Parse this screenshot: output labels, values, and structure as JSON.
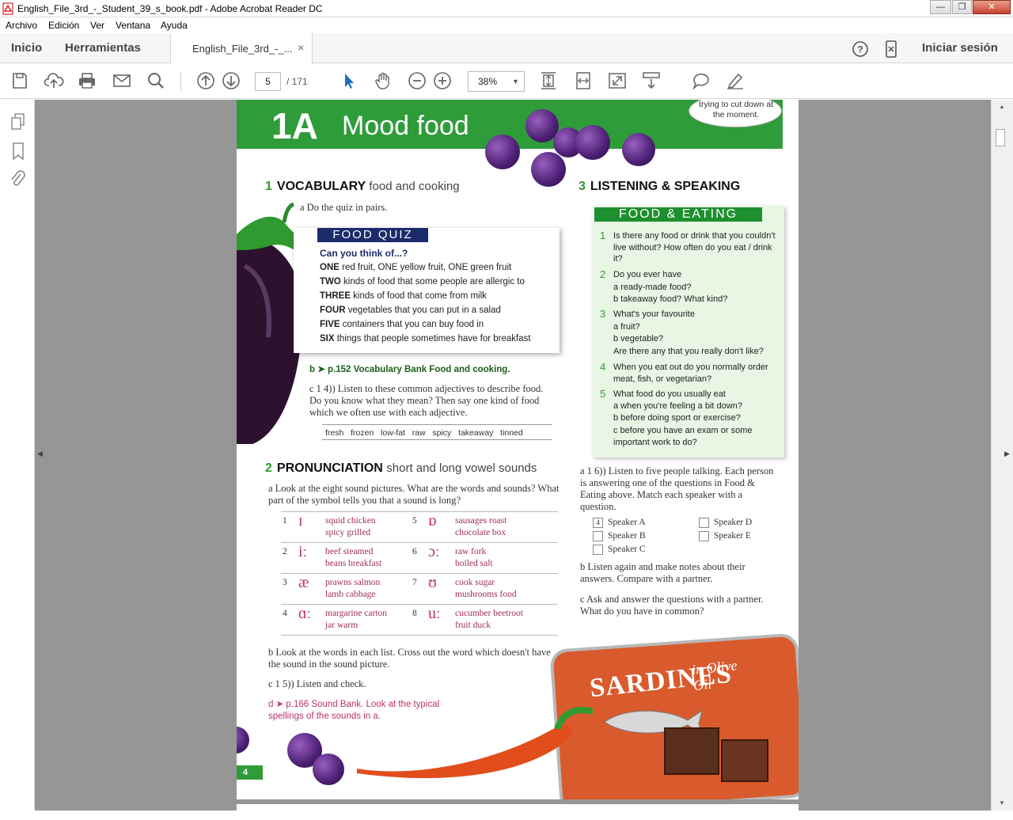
{
  "window": {
    "title": "English_File_3rd_-_Student_39_s_book.pdf - Adobe Acrobat Reader DC",
    "minimize": "—",
    "maximize": "❐",
    "close": "✕"
  },
  "menu": [
    "Archivo",
    "Edición",
    "Ver",
    "Ventana",
    "Ayuda"
  ],
  "tabs": {
    "home": "Inicio",
    "tools": "Herramientas",
    "doc": "English_File_3rd_-_...",
    "doc_close": "×",
    "signin": "Iniciar sesión"
  },
  "toolbar": {
    "page_current": "5",
    "page_total": "/ 171",
    "zoom": "38%"
  },
  "page": {
    "lesson_num": "1A",
    "lesson_title": "Mood food",
    "bubble": "trying to cut down at the moment.",
    "s1_num": "1",
    "s1_title": "VOCABULARY",
    "s1_sub": "food and cooking",
    "s1_a": "a   Do the quiz in pairs.",
    "quiz_title": "FOOD QUIZ",
    "quiz_q": "Can you think of...?",
    "quiz_lines": [
      {
        "k": "ONE",
        "t": " red fruit, ONE yellow fruit, ONE green fruit"
      },
      {
        "k": "TWO",
        "t": " kinds of food that some people are allergic to"
      },
      {
        "k": "THREE",
        "t": " kinds of food that come from milk"
      },
      {
        "k": "FOUR",
        "t": " vegetables that you can put in a salad"
      },
      {
        "k": "FIVE",
        "t": " containers that you can buy food in"
      },
      {
        "k": "SIX",
        "t": " things that people sometimes have for breakfast"
      }
    ],
    "s1_b": "b  ➤ p.152 Vocabulary Bank Food and cooking.",
    "s1_c": "c   1 4)) Listen to these common adjectives to describe food. Do you know what they mean? Then say one kind of food which we often use with each adjective.",
    "adjectives": "fresh   frozen   low-fat   raw   spicy   takeaway   tinned",
    "s2_num": "2",
    "s2_title": "PRONUNCIATION",
    "s2_sub": "short and long vowel sounds",
    "s2_a": "a   Look at the eight sound pictures. What are the words and sounds? What part of the symbol tells you that a sound is long?",
    "sounds": [
      {
        "n": "1",
        "sym": "ɪ",
        "w1": "squid   chicken",
        "w2": "spicy   grilled"
      },
      {
        "n": "5",
        "sym": "ɒ",
        "w1": "sausages   roast",
        "w2": "chocolate   box"
      },
      {
        "n": "2",
        "sym": "iː",
        "w1": "beef   steamed",
        "w2": "beans   breakfast"
      },
      {
        "n": "6",
        "sym": "ɔː",
        "w1": "raw   fork",
        "w2": "boiled   salt"
      },
      {
        "n": "3",
        "sym": "æ",
        "w1": "prawns   salmon",
        "w2": "lamb   cabbage"
      },
      {
        "n": "7",
        "sym": "ʊ",
        "w1": "cook   sugar",
        "w2": "mushrooms   food"
      },
      {
        "n": "4",
        "sym": "ɑː",
        "w1": "margarine   carton",
        "w2": "jar   warm"
      },
      {
        "n": "8",
        "sym": "uː",
        "w1": "cucumber   beetroot",
        "w2": "fruit   duck"
      }
    ],
    "s2_b": "b   Look at the words in each list. Cross out the word which doesn't have the sound in the sound picture.",
    "s2_c": "c   1 5)) Listen and check.",
    "s2_d": "d  ➤ p.166 Sound Bank. Look at the typical spellings of the sounds in a.",
    "s3_num": "3",
    "s3_title": "LISTENING & SPEAKING",
    "fe_title": "FOOD & EATING",
    "fe_lines": [
      "Is there any food or drink that you couldn't live without? How often do you eat / drink it?",
      "Do you ever have",
      "a  ready-made food?",
      "b  takeaway food? What kind?",
      "What's your favourite",
      "a  fruit?",
      "b  vegetable?",
      "Are there any that you really don't like?",
      "When you eat out do you normally order meat, fish, or vegetarian?",
      "What food do you usually eat",
      "a  when you're feeling a bit down?",
      "b  before doing sport or exercise?",
      "c  before you have an exam or some important work to do?"
    ],
    "fe_nums": [
      "1",
      "2",
      "3",
      "4",
      "5"
    ],
    "s3_a": "a   1 6)) Listen to five people talking. Each person is answering one of the questions in Food & Eating above. Match each speaker with a question.",
    "speakers": [
      "Speaker A",
      "Speaker B",
      "Speaker C",
      "Speaker D",
      "Speaker E"
    ],
    "speaker_a_val": "4",
    "s3_b": "b   Listen again and make notes about their answers. Compare with a partner.",
    "s3_c": "c   Ask and answer the questions with a partner. What do you have in common?",
    "tin_text": "SARDINES",
    "tin_text2": "in Olive Oil",
    "page_no": "4"
  }
}
